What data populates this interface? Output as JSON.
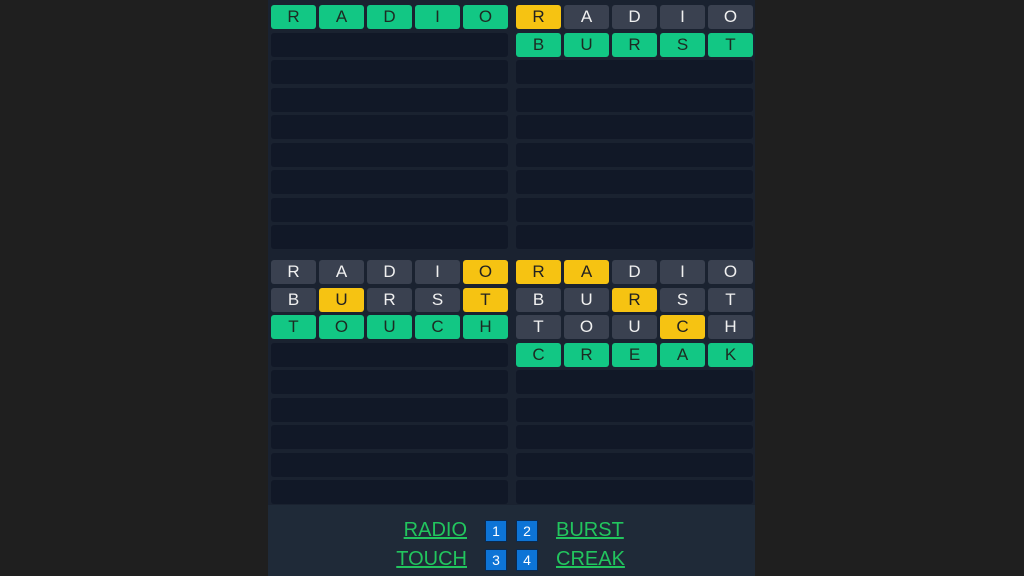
{
  "colors": {
    "green": "#12c784",
    "yellow": "#f6c312",
    "gray": "#3a4150",
    "empty": "#111827"
  },
  "rows_per_board": 9,
  "boards": [
    {
      "guesses": [
        {
          "word": "RADIO",
          "marks": "ggggg"
        }
      ]
    },
    {
      "guesses": [
        {
          "word": "RADIO",
          "marks": "yxxxx"
        },
        {
          "word": "BURST",
          "marks": "ggggg"
        }
      ]
    },
    {
      "guesses": [
        {
          "word": "RADIO",
          "marks": "xxxxy"
        },
        {
          "word": "BURST",
          "marks": "xyxxy"
        },
        {
          "word": "TOUCH",
          "marks": "ggggg"
        }
      ]
    },
    {
      "guesses": [
        {
          "word": "RADIO",
          "marks": "yyxxx"
        },
        {
          "word": "BURST",
          "marks": "xxyxx"
        },
        {
          "word": "TOUCH",
          "marks": "xxxyx"
        },
        {
          "word": "CREAK",
          "marks": "ggggg"
        }
      ]
    }
  ],
  "footer": {
    "answers": [
      "RADIO",
      "BURST",
      "TOUCH",
      "CREAK"
    ],
    "numbers": [
      "1",
      "2",
      "3",
      "4"
    ]
  }
}
